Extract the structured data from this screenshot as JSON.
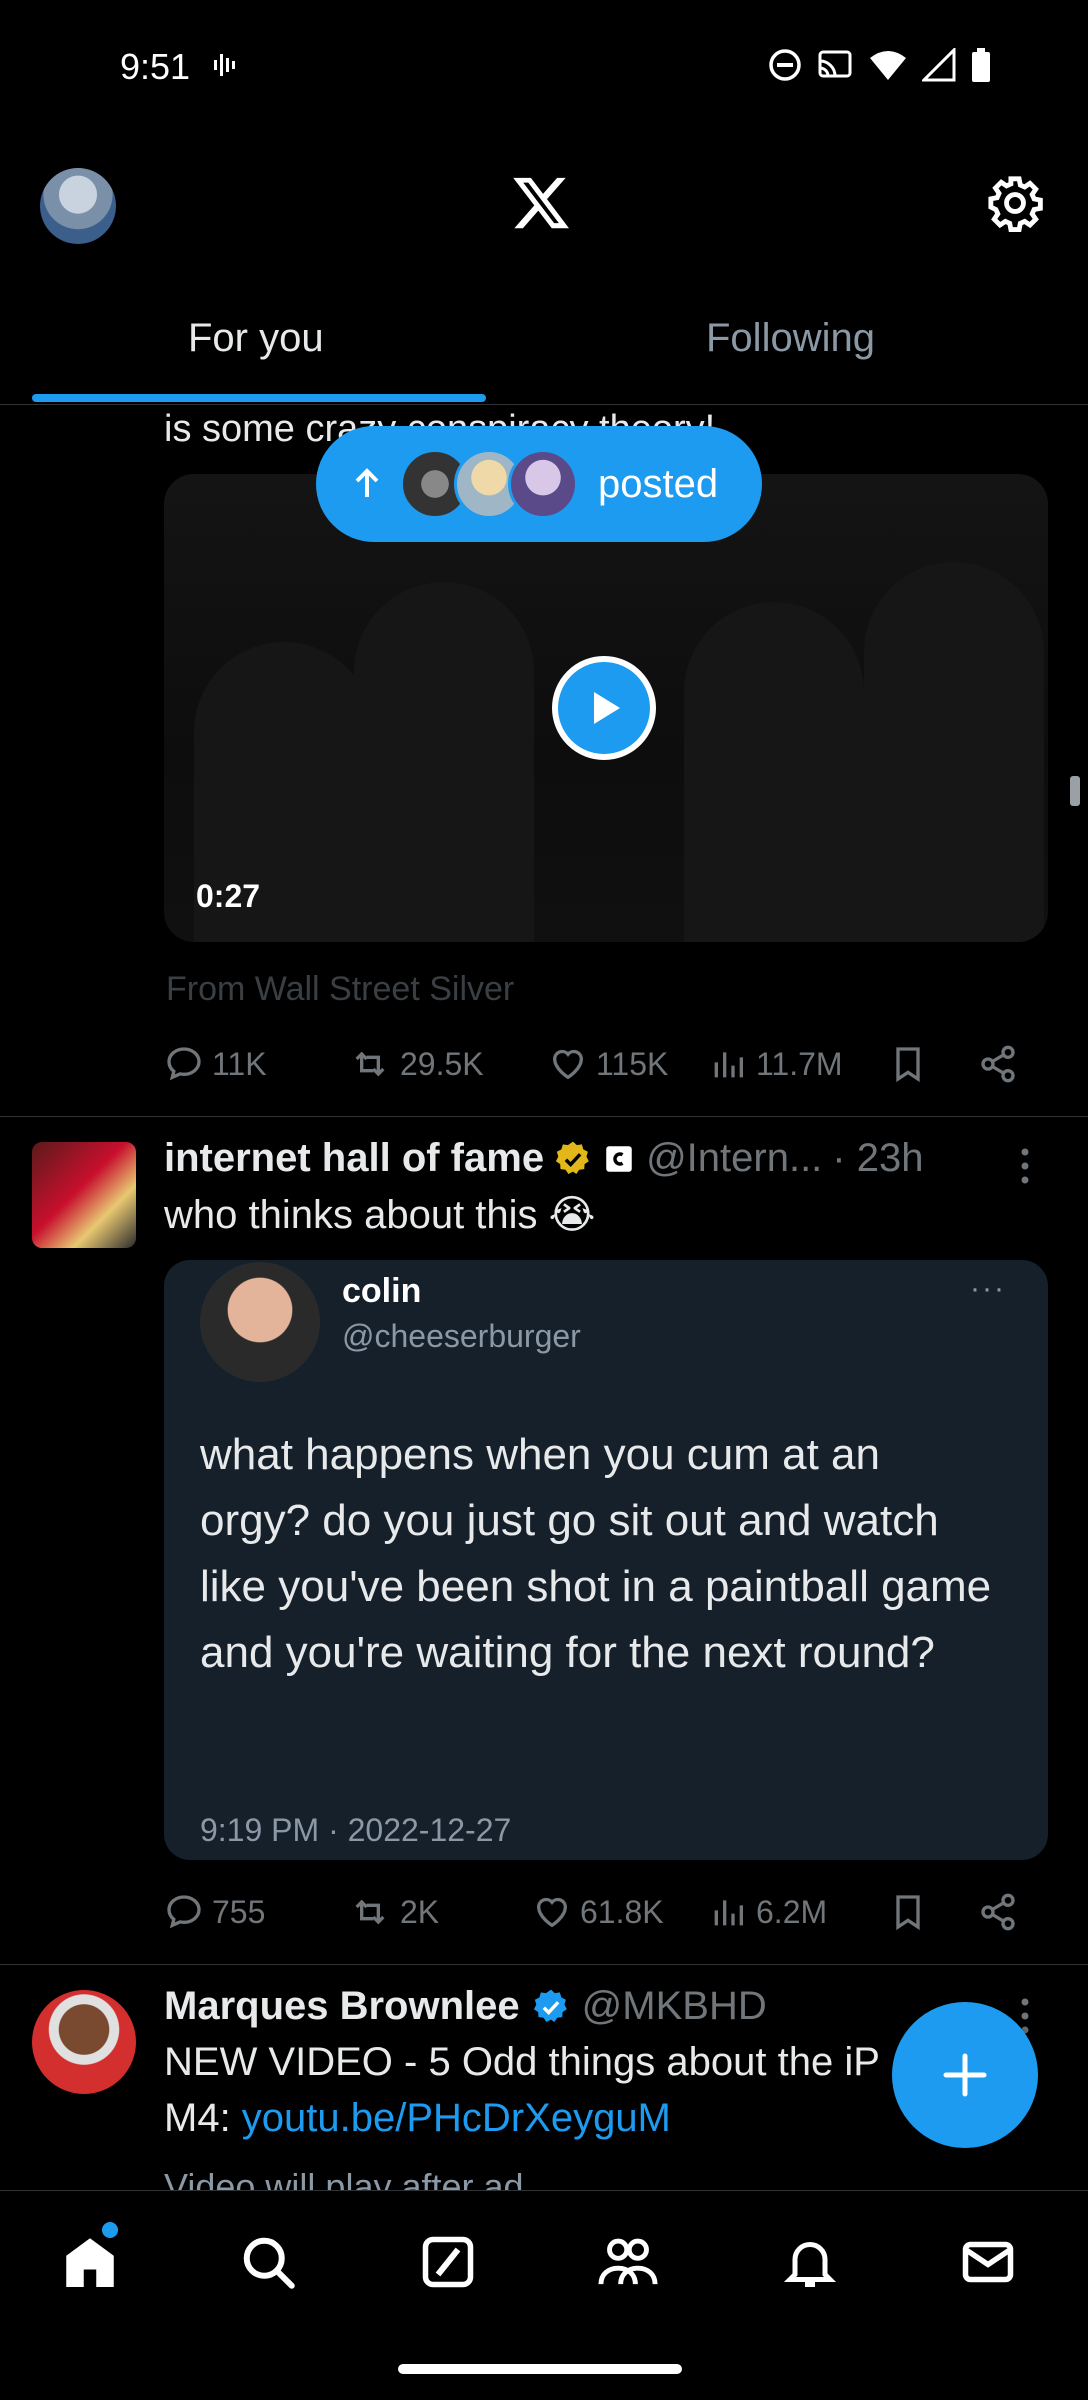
{
  "status_bar": {
    "time": "9:51"
  },
  "tabs": [
    {
      "label": "For you",
      "active": true
    },
    {
      "label": "Following",
      "active": false
    }
  ],
  "posted_pill": {
    "label": "posted"
  },
  "tweet1": {
    "text_fragment": "is some crazy conspiracy theory!",
    "video_duration": "0:27",
    "from_text": "From Wall Street Silver",
    "actions": {
      "replies": "11K",
      "reposts": "29.5K",
      "likes": "115K",
      "views": "11.7M"
    }
  },
  "tweet2": {
    "name": "internet hall of fame",
    "handle": "@Intern...",
    "time": "· 23h",
    "text": "who thinks about this 😭",
    "quote": {
      "name": "colin",
      "handle": "@cheeserburger",
      "more": "···",
      "body": "what happens when you cum at an orgy? do you just go sit out and watch like you've been shot in a paintball game and you're waiting for the next round?",
      "date": "9:19 PM · 2022-12-27"
    },
    "actions": {
      "replies": "755",
      "reposts": "2K",
      "likes": "61.8K",
      "views": "6.2M"
    }
  },
  "tweet3": {
    "name": "Marques Brownlee",
    "handle": "@MKBHD",
    "text_line1": "NEW VIDEO - 5 Odd things about the iP",
    "text_line2_prefix": "M4: ",
    "link": "youtu.be/PHcDrXeyguM",
    "fade_text": "Video will play after ad"
  },
  "colors": {
    "accent": "#1d9bf0",
    "background": "#000000",
    "muted": "#71767b"
  },
  "icons": {
    "nav": [
      "home-icon",
      "search-icon",
      "grok-icon",
      "communities-icon",
      "notifications-icon",
      "messages-icon"
    ],
    "header": [
      "x-logo-icon",
      "gear-icon"
    ]
  }
}
